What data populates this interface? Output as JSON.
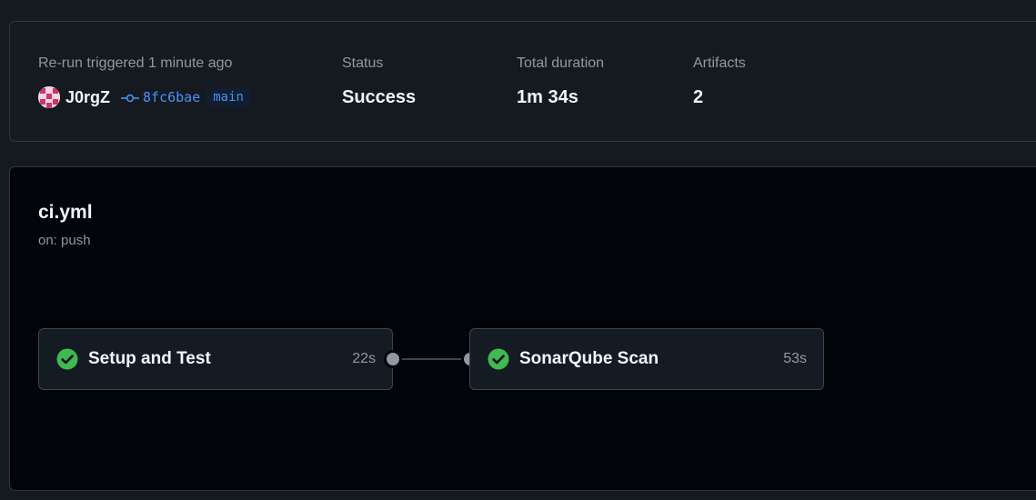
{
  "summary": {
    "trigger_label": "Re-run triggered 1 minute ago",
    "actor": "J0rgZ",
    "commit_sha": "8fc6bae",
    "branch": "main",
    "status_label": "Status",
    "status_value": "Success",
    "duration_label": "Total duration",
    "duration_value": "1m 34s",
    "artifacts_label": "Artifacts",
    "artifacts_value": "2"
  },
  "workflow": {
    "file": "ci.yml",
    "trigger": "on: push",
    "jobs": [
      {
        "name": "Setup and Test",
        "duration": "22s",
        "status_icon": "check-circle-icon"
      },
      {
        "name": "SonarQube Scan",
        "duration": "53s",
        "status_icon": "check-circle-icon"
      }
    ]
  },
  "colors": {
    "success": "#3fb950",
    "link": "#4493f8",
    "muted": "#9198a1"
  }
}
